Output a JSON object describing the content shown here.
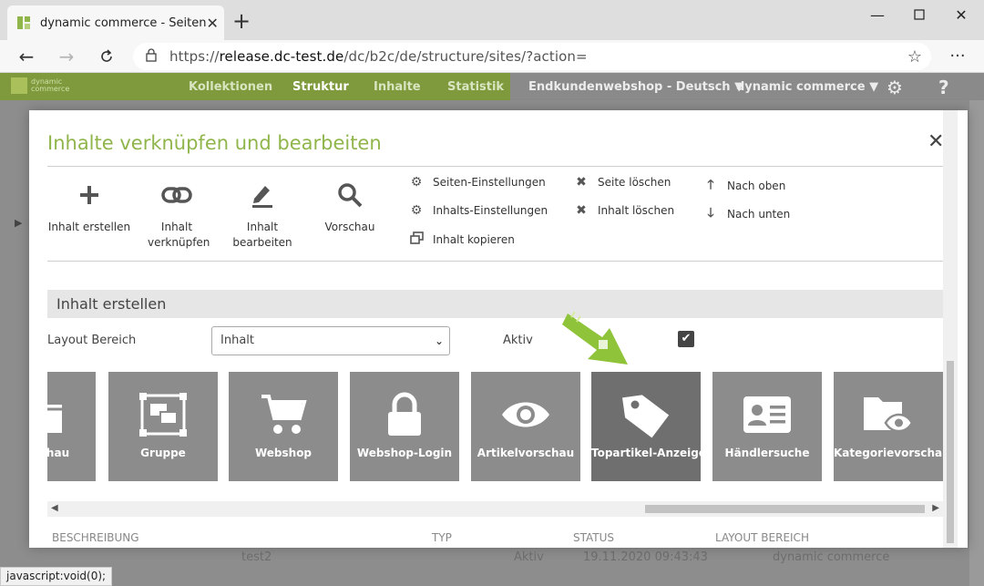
{
  "browser": {
    "tab_title": "dynamic commerce - Seiten",
    "url_prefix": "https://",
    "url_host": "release.dc-test.de",
    "url_path": "/dc/b2c/de/structure/sites/?action="
  },
  "app": {
    "logo_line1": "dynamic",
    "logo_line2": "commerce",
    "nav": [
      "Kollektionen",
      "Struktur",
      "Inhalte",
      "Statistik"
    ],
    "shop_select": "Endkundenwebshop - Deutsch",
    "company_select": "dynamic commerce",
    "help": "?"
  },
  "background": {
    "row_name": "test2",
    "row_status": "Aktiv",
    "row_date": "19.11.2020 09:43:43",
    "row_area": "dynamic commerce"
  },
  "status_tip": "javascript:void(0);",
  "modal": {
    "title": "Inhalte verknüpfen und bearbeiten",
    "tools": [
      {
        "label": "Inhalt erstellen"
      },
      {
        "label": "Inhalt verknüpfen"
      },
      {
        "label": "Inhalt bearbeiten"
      },
      {
        "label": "Vorschau"
      }
    ],
    "links": {
      "site_settings": "Seiten-Einstellungen",
      "content_settings": "Inhalts-Einstellungen",
      "copy_content": "Inhalt kopieren",
      "delete_site": "Seite löschen",
      "delete_content": "Inhalt löschen",
      "move_up": "Nach oben",
      "move_down": "Nach unten"
    },
    "section_title": "Inhalt erstellen",
    "layout_label": "Layout Bereich",
    "layout_value": "Inhalt",
    "active_label": "Aktiv",
    "tiles": [
      {
        "label": "Vorschau"
      },
      {
        "label": "Gruppe"
      },
      {
        "label": "Webshop"
      },
      {
        "label": "Webshop-Login"
      },
      {
        "label": "Artikelvorschau"
      },
      {
        "label": "Topartikel-Anzeige"
      },
      {
        "label": "Händlersuche"
      },
      {
        "label": "Kategorievorschau"
      }
    ],
    "columns": [
      "BESCHREIBUNG",
      "TYP",
      "STATUS",
      "LAYOUT BEREICH"
    ]
  },
  "colors": {
    "accent_green": "#8fb54b",
    "header_green": "#7e9a3c",
    "tile_gray": "#8c8c8c",
    "tile_active": "#6f6f6f"
  }
}
